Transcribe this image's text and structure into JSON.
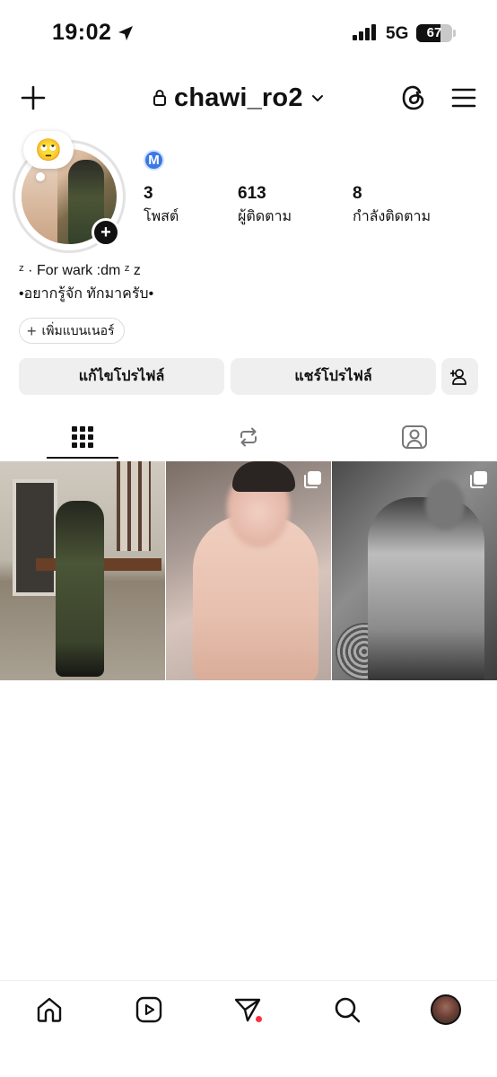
{
  "status_bar": {
    "time": "19:02",
    "network": "5G",
    "battery": "67",
    "battery_level": 0.67
  },
  "header": {
    "username": "chawi_ro2"
  },
  "profile": {
    "note_emoji": "🙄",
    "badge": "M",
    "stats": [
      {
        "value": "3",
        "label": "โพสต์"
      },
      {
        "value": "613",
        "label": "ผู้ติดตาม"
      },
      {
        "value": "8",
        "label": "กำลังติดตาม"
      }
    ],
    "bio": [
      "ᶻ · For wark :dm ᶻ z",
      "•อยากรู้จัก ทักมาครับ•"
    ],
    "banner_button": "เพิ่มแบนเนอร์"
  },
  "actions": {
    "edit": "แก้ไขโปรไฟล์",
    "share": "แชร์โปรไฟล์"
  },
  "colors": {
    "meta_badge": "#3a78e6",
    "notification_dot": "#ff3040",
    "button_bg": "#efefef"
  }
}
